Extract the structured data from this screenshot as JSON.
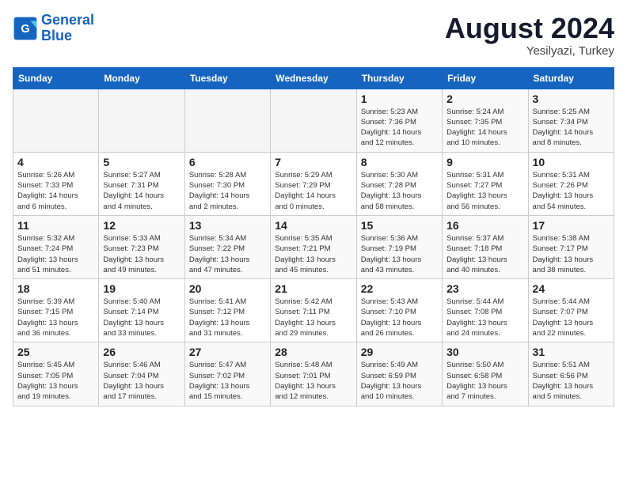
{
  "header": {
    "logo_line1": "General",
    "logo_line2": "Blue",
    "month_title": "August 2024",
    "subtitle": "Yesilyazi, Turkey"
  },
  "days_of_week": [
    "Sunday",
    "Monday",
    "Tuesday",
    "Wednesday",
    "Thursday",
    "Friday",
    "Saturday"
  ],
  "weeks": [
    [
      {
        "day": "",
        "info": ""
      },
      {
        "day": "",
        "info": ""
      },
      {
        "day": "",
        "info": ""
      },
      {
        "day": "",
        "info": ""
      },
      {
        "day": "1",
        "info": "Sunrise: 5:23 AM\nSunset: 7:36 PM\nDaylight: 14 hours\nand 12 minutes."
      },
      {
        "day": "2",
        "info": "Sunrise: 5:24 AM\nSunset: 7:35 PM\nDaylight: 14 hours\nand 10 minutes."
      },
      {
        "day": "3",
        "info": "Sunrise: 5:25 AM\nSunset: 7:34 PM\nDaylight: 14 hours\nand 8 minutes."
      }
    ],
    [
      {
        "day": "4",
        "info": "Sunrise: 5:26 AM\nSunset: 7:33 PM\nDaylight: 14 hours\nand 6 minutes."
      },
      {
        "day": "5",
        "info": "Sunrise: 5:27 AM\nSunset: 7:31 PM\nDaylight: 14 hours\nand 4 minutes."
      },
      {
        "day": "6",
        "info": "Sunrise: 5:28 AM\nSunset: 7:30 PM\nDaylight: 14 hours\nand 2 minutes."
      },
      {
        "day": "7",
        "info": "Sunrise: 5:29 AM\nSunset: 7:29 PM\nDaylight: 14 hours\nand 0 minutes."
      },
      {
        "day": "8",
        "info": "Sunrise: 5:30 AM\nSunset: 7:28 PM\nDaylight: 13 hours\nand 58 minutes."
      },
      {
        "day": "9",
        "info": "Sunrise: 5:31 AM\nSunset: 7:27 PM\nDaylight: 13 hours\nand 56 minutes."
      },
      {
        "day": "10",
        "info": "Sunrise: 5:31 AM\nSunset: 7:26 PM\nDaylight: 13 hours\nand 54 minutes."
      }
    ],
    [
      {
        "day": "11",
        "info": "Sunrise: 5:32 AM\nSunset: 7:24 PM\nDaylight: 13 hours\nand 51 minutes."
      },
      {
        "day": "12",
        "info": "Sunrise: 5:33 AM\nSunset: 7:23 PM\nDaylight: 13 hours\nand 49 minutes."
      },
      {
        "day": "13",
        "info": "Sunrise: 5:34 AM\nSunset: 7:22 PM\nDaylight: 13 hours\nand 47 minutes."
      },
      {
        "day": "14",
        "info": "Sunrise: 5:35 AM\nSunset: 7:21 PM\nDaylight: 13 hours\nand 45 minutes."
      },
      {
        "day": "15",
        "info": "Sunrise: 5:36 AM\nSunset: 7:19 PM\nDaylight: 13 hours\nand 43 minutes."
      },
      {
        "day": "16",
        "info": "Sunrise: 5:37 AM\nSunset: 7:18 PM\nDaylight: 13 hours\nand 40 minutes."
      },
      {
        "day": "17",
        "info": "Sunrise: 5:38 AM\nSunset: 7:17 PM\nDaylight: 13 hours\nand 38 minutes."
      }
    ],
    [
      {
        "day": "18",
        "info": "Sunrise: 5:39 AM\nSunset: 7:15 PM\nDaylight: 13 hours\nand 36 minutes."
      },
      {
        "day": "19",
        "info": "Sunrise: 5:40 AM\nSunset: 7:14 PM\nDaylight: 13 hours\nand 33 minutes."
      },
      {
        "day": "20",
        "info": "Sunrise: 5:41 AM\nSunset: 7:12 PM\nDaylight: 13 hours\nand 31 minutes."
      },
      {
        "day": "21",
        "info": "Sunrise: 5:42 AM\nSunset: 7:11 PM\nDaylight: 13 hours\nand 29 minutes."
      },
      {
        "day": "22",
        "info": "Sunrise: 5:43 AM\nSunset: 7:10 PM\nDaylight: 13 hours\nand 26 minutes."
      },
      {
        "day": "23",
        "info": "Sunrise: 5:44 AM\nSunset: 7:08 PM\nDaylight: 13 hours\nand 24 minutes."
      },
      {
        "day": "24",
        "info": "Sunrise: 5:44 AM\nSunset: 7:07 PM\nDaylight: 13 hours\nand 22 minutes."
      }
    ],
    [
      {
        "day": "25",
        "info": "Sunrise: 5:45 AM\nSunset: 7:05 PM\nDaylight: 13 hours\nand 19 minutes."
      },
      {
        "day": "26",
        "info": "Sunrise: 5:46 AM\nSunset: 7:04 PM\nDaylight: 13 hours\nand 17 minutes."
      },
      {
        "day": "27",
        "info": "Sunrise: 5:47 AM\nSunset: 7:02 PM\nDaylight: 13 hours\nand 15 minutes."
      },
      {
        "day": "28",
        "info": "Sunrise: 5:48 AM\nSunset: 7:01 PM\nDaylight: 13 hours\nand 12 minutes."
      },
      {
        "day": "29",
        "info": "Sunrise: 5:49 AM\nSunset: 6:59 PM\nDaylight: 13 hours\nand 10 minutes."
      },
      {
        "day": "30",
        "info": "Sunrise: 5:50 AM\nSunset: 6:58 PM\nDaylight: 13 hours\nand 7 minutes."
      },
      {
        "day": "31",
        "info": "Sunrise: 5:51 AM\nSunset: 6:56 PM\nDaylight: 13 hours\nand 5 minutes."
      }
    ]
  ]
}
